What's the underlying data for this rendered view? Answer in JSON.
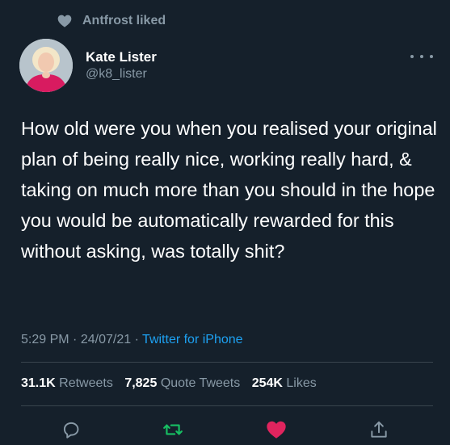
{
  "social_context": {
    "icon": "heart-icon",
    "text": "Antfrost liked"
  },
  "author": {
    "display_name": "Kate Lister",
    "handle": "@k8_lister",
    "avatar_icon": "avatar"
  },
  "more_icon": "more-horizontal-icon",
  "tweet": {
    "text": "How old were you when you realised your original plan of being really nice, working really hard, & taking on much more than you should in the hope you would be automatically rewarded for this without asking, was totally shit?"
  },
  "meta": {
    "time": "5:29 PM",
    "separator": "·",
    "date": "24/07/21",
    "source": "Twitter for iPhone"
  },
  "stats": {
    "retweets_count": "31.1K",
    "retweets_label": "Retweets",
    "quotes_count": "7,825",
    "quotes_label": "Quote Tweets",
    "likes_count": "254K",
    "likes_label": "Likes"
  },
  "actions": {
    "reply_icon": "reply-icon",
    "retweet_icon": "retweet-icon",
    "like_icon": "like-icon",
    "share_icon": "share-icon"
  },
  "colors": {
    "background": "#15202b",
    "secondary_text": "#8899a6",
    "link": "#1da1f2",
    "retweet_green": "#17bf63",
    "like_pink": "#e0245e",
    "divider": "#38444d"
  }
}
